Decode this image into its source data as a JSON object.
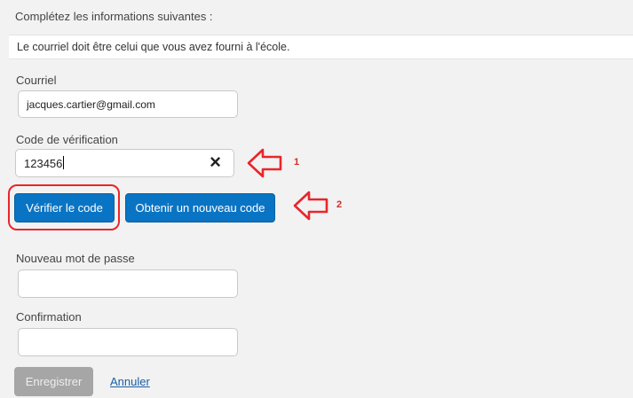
{
  "form": {
    "intro": "Complétez les informations suivantes :",
    "notice": "Le courriel doit être celui que vous avez fourni à l'école.",
    "email": {
      "label": "Courriel",
      "value": "jacques.cartier@gmail.com"
    },
    "code": {
      "label": "Code de vérification",
      "value": "123456",
      "clear_icon": "×"
    },
    "verify_button": "Vérifier le code",
    "new_code_button": "Obtenir un nouveau code",
    "new_password": {
      "label": "Nouveau mot de passe",
      "value": ""
    },
    "confirmation": {
      "label": "Confirmation",
      "value": ""
    },
    "save_button": "Enregistrer",
    "cancel_link": "Annuler"
  },
  "annotations": {
    "arrow_icon": "left-arrow-outline-icon",
    "color": "#e8262b",
    "marker_1": "1",
    "marker_2": "2"
  },
  "colors": {
    "primary_button": "#0a74c4",
    "disabled_button": "#a6a6a6",
    "link": "#1a5ea8"
  }
}
